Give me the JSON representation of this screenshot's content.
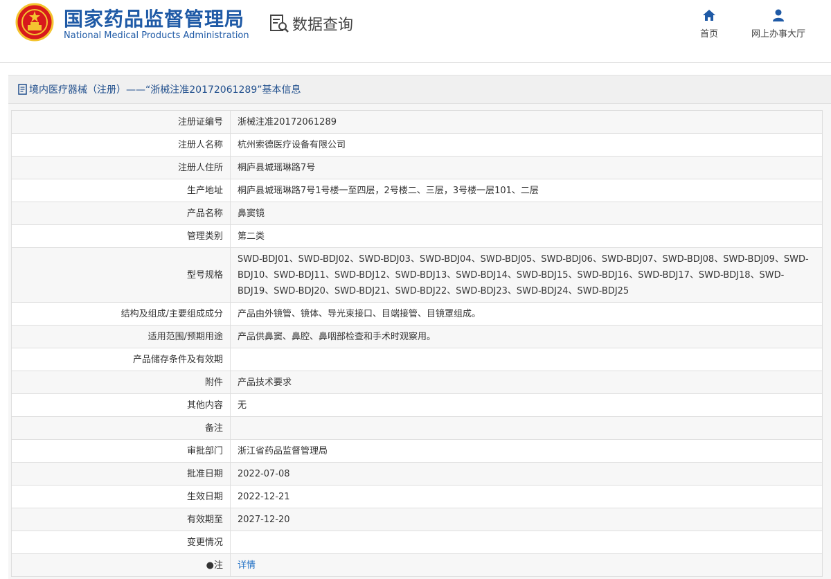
{
  "header": {
    "org_cn": "国家药品监督管理局",
    "org_en": "National Medical Products Administration",
    "query_label": "数据查询",
    "nav": [
      {
        "label": "首页",
        "icon": "home-icon"
      },
      {
        "label": "网上办事大厅",
        "icon": "user-icon"
      }
    ]
  },
  "panel": {
    "title": "境内医疗器械（注册）——“浙械注准20172061289”基本信息"
  },
  "rows": [
    {
      "key": "注册证编号",
      "value": "浙械注准20172061289"
    },
    {
      "key": "注册人名称",
      "value": "杭州索德医疗设备有限公司"
    },
    {
      "key": "注册人住所",
      "value": "桐庐县城瑶琳路7号"
    },
    {
      "key": "生产地址",
      "value": "桐庐县城瑶琳路7号1号楼一至四层，2号楼二、三层，3号楼一层101、二层"
    },
    {
      "key": "产品名称",
      "value": "鼻窦镜"
    },
    {
      "key": "管理类别",
      "value": "第二类"
    },
    {
      "key": "型号规格",
      "value": "SWD-BDJ01、SWD-BDJ02、SWD-BDJ03、SWD-BDJ04、SWD-BDJ05、SWD-BDJ06、SWD-BDJ07、SWD-BDJ08、SWD-BDJ09、SWD-BDJ10、SWD-BDJ11、SWD-BDJ12、SWD-BDJ13、SWD-BDJ14、SWD-BDJ15、SWD-BDJ16、SWD-BDJ17、SWD-BDJ18、SWD-BDJ19、SWD-BDJ20、SWD-BDJ21、SWD-BDJ22、SWD-BDJ23、SWD-BDJ24、SWD-BDJ25"
    },
    {
      "key": "结构及组成/主要组成成分",
      "value": "产品由外镜管、镜体、导光束接口、目端接管、目镜罩组成。"
    },
    {
      "key": "适用范围/预期用途",
      "value": "产品供鼻窦、鼻腔、鼻咽部检查和手术时观察用。"
    },
    {
      "key": "产品储存条件及有效期",
      "value": ""
    },
    {
      "key": "附件",
      "value": "产品技术要求"
    },
    {
      "key": "其他内容",
      "value": "无"
    },
    {
      "key": "备注",
      "value": ""
    },
    {
      "key": "审批部门",
      "value": "浙江省药品监督管理局"
    },
    {
      "key": "批准日期",
      "value": "2022-07-08"
    },
    {
      "key": "生效日期",
      "value": "2022-12-21"
    },
    {
      "key": "有效期至",
      "value": "2027-12-20"
    },
    {
      "key": "变更情况",
      "value": ""
    },
    {
      "key": "●注",
      "value": "详情"
    }
  ],
  "colors": {
    "brand_blue": "#1f5aa6",
    "title_blue": "#1f4e8c",
    "link_blue": "#1f6fc4",
    "emblem_red": "#d7191c",
    "emblem_gold": "#f4c430"
  }
}
